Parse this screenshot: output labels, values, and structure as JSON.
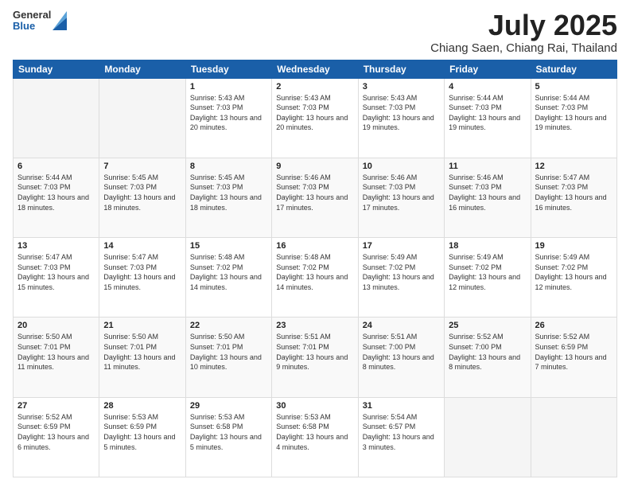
{
  "header": {
    "logo_general": "General",
    "logo_blue": "Blue",
    "title": "July 2025",
    "location": "Chiang Saen, Chiang Rai, Thailand"
  },
  "weekdays": [
    "Sunday",
    "Monday",
    "Tuesday",
    "Wednesday",
    "Thursday",
    "Friday",
    "Saturday"
  ],
  "weeks": [
    [
      {
        "day": "",
        "info": ""
      },
      {
        "day": "",
        "info": ""
      },
      {
        "day": "1",
        "info": "Sunrise: 5:43 AM\nSunset: 7:03 PM\nDaylight: 13 hours and 20 minutes."
      },
      {
        "day": "2",
        "info": "Sunrise: 5:43 AM\nSunset: 7:03 PM\nDaylight: 13 hours and 20 minutes."
      },
      {
        "day": "3",
        "info": "Sunrise: 5:43 AM\nSunset: 7:03 PM\nDaylight: 13 hours and 19 minutes."
      },
      {
        "day": "4",
        "info": "Sunrise: 5:44 AM\nSunset: 7:03 PM\nDaylight: 13 hours and 19 minutes."
      },
      {
        "day": "5",
        "info": "Sunrise: 5:44 AM\nSunset: 7:03 PM\nDaylight: 13 hours and 19 minutes."
      }
    ],
    [
      {
        "day": "6",
        "info": "Sunrise: 5:44 AM\nSunset: 7:03 PM\nDaylight: 13 hours and 18 minutes."
      },
      {
        "day": "7",
        "info": "Sunrise: 5:45 AM\nSunset: 7:03 PM\nDaylight: 13 hours and 18 minutes."
      },
      {
        "day": "8",
        "info": "Sunrise: 5:45 AM\nSunset: 7:03 PM\nDaylight: 13 hours and 18 minutes."
      },
      {
        "day": "9",
        "info": "Sunrise: 5:46 AM\nSunset: 7:03 PM\nDaylight: 13 hours and 17 minutes."
      },
      {
        "day": "10",
        "info": "Sunrise: 5:46 AM\nSunset: 7:03 PM\nDaylight: 13 hours and 17 minutes."
      },
      {
        "day": "11",
        "info": "Sunrise: 5:46 AM\nSunset: 7:03 PM\nDaylight: 13 hours and 16 minutes."
      },
      {
        "day": "12",
        "info": "Sunrise: 5:47 AM\nSunset: 7:03 PM\nDaylight: 13 hours and 16 minutes."
      }
    ],
    [
      {
        "day": "13",
        "info": "Sunrise: 5:47 AM\nSunset: 7:03 PM\nDaylight: 13 hours and 15 minutes."
      },
      {
        "day": "14",
        "info": "Sunrise: 5:47 AM\nSunset: 7:03 PM\nDaylight: 13 hours and 15 minutes."
      },
      {
        "day": "15",
        "info": "Sunrise: 5:48 AM\nSunset: 7:02 PM\nDaylight: 13 hours and 14 minutes."
      },
      {
        "day": "16",
        "info": "Sunrise: 5:48 AM\nSunset: 7:02 PM\nDaylight: 13 hours and 14 minutes."
      },
      {
        "day": "17",
        "info": "Sunrise: 5:49 AM\nSunset: 7:02 PM\nDaylight: 13 hours and 13 minutes."
      },
      {
        "day": "18",
        "info": "Sunrise: 5:49 AM\nSunset: 7:02 PM\nDaylight: 13 hours and 12 minutes."
      },
      {
        "day": "19",
        "info": "Sunrise: 5:49 AM\nSunset: 7:02 PM\nDaylight: 13 hours and 12 minutes."
      }
    ],
    [
      {
        "day": "20",
        "info": "Sunrise: 5:50 AM\nSunset: 7:01 PM\nDaylight: 13 hours and 11 minutes."
      },
      {
        "day": "21",
        "info": "Sunrise: 5:50 AM\nSunset: 7:01 PM\nDaylight: 13 hours and 11 minutes."
      },
      {
        "day": "22",
        "info": "Sunrise: 5:50 AM\nSunset: 7:01 PM\nDaylight: 13 hours and 10 minutes."
      },
      {
        "day": "23",
        "info": "Sunrise: 5:51 AM\nSunset: 7:01 PM\nDaylight: 13 hours and 9 minutes."
      },
      {
        "day": "24",
        "info": "Sunrise: 5:51 AM\nSunset: 7:00 PM\nDaylight: 13 hours and 8 minutes."
      },
      {
        "day": "25",
        "info": "Sunrise: 5:52 AM\nSunset: 7:00 PM\nDaylight: 13 hours and 8 minutes."
      },
      {
        "day": "26",
        "info": "Sunrise: 5:52 AM\nSunset: 6:59 PM\nDaylight: 13 hours and 7 minutes."
      }
    ],
    [
      {
        "day": "27",
        "info": "Sunrise: 5:52 AM\nSunset: 6:59 PM\nDaylight: 13 hours and 6 minutes."
      },
      {
        "day": "28",
        "info": "Sunrise: 5:53 AM\nSunset: 6:59 PM\nDaylight: 13 hours and 5 minutes."
      },
      {
        "day": "29",
        "info": "Sunrise: 5:53 AM\nSunset: 6:58 PM\nDaylight: 13 hours and 5 minutes."
      },
      {
        "day": "30",
        "info": "Sunrise: 5:53 AM\nSunset: 6:58 PM\nDaylight: 13 hours and 4 minutes."
      },
      {
        "day": "31",
        "info": "Sunrise: 5:54 AM\nSunset: 6:57 PM\nDaylight: 13 hours and 3 minutes."
      },
      {
        "day": "",
        "info": ""
      },
      {
        "day": "",
        "info": ""
      }
    ]
  ]
}
